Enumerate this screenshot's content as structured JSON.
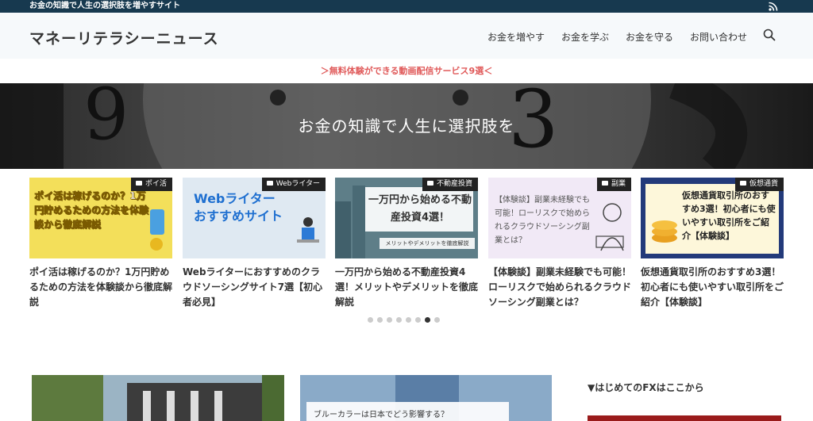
{
  "topbar": {
    "tagline": "お金の知識で人生の選択肢を増やすサイト"
  },
  "header": {
    "site_title": "マネーリテラシーニュース",
    "nav": [
      "お金を増やす",
      "お金を学ぶ",
      "お金を守る",
      "お問い合わせ"
    ]
  },
  "notice": {
    "text": "＞無料体験ができる動画配信サービス9選＜"
  },
  "hero": {
    "text": "お金の知識で人生に選択肢を"
  },
  "cards": [
    {
      "category": "ポイ活",
      "thumb_text": "ポイ活は稼げるのか？1万円貯めるための方法を体験談から徹底解説",
      "title": "ポイ活は稼げるのか？1万円貯めるための方法を体験談から徹底解説"
    },
    {
      "category": "Webライター",
      "thumb_text": "Webライター おすすめサイト",
      "title": "Webライターにおすすめのクラウドソーシングサイト7選【初心者必見】"
    },
    {
      "category": "不動産投資",
      "thumb_text": "一万円から始める不動産投資4選！",
      "thumb_sub": "メリットやデメリットを徹底解説",
      "title": "一万円から始める不動産投資4選！メリットやデメリットを徹底解説"
    },
    {
      "category": "副業",
      "thumb_text": "【体験談】副業未経験でも可能！ローリスクで始められるクラウドソーシング副業とは？",
      "title": "【体験談】副業未経験でも可能！ローリスクで始められるクラウドソーシング副業とは？"
    },
    {
      "category": "仮想通貨",
      "thumb_text": "仮想通貨取引所のおすすめ3選！初心者にも使いやすい取引所をご紹介【体験談】",
      "title": "仮想通貨取引所のおすすめ3選！初心者にも使いやすい取引所をご紹介【体験談】"
    }
  ],
  "dots": {
    "count": 8,
    "active": 6
  },
  "lower": {
    "card2_caption": "ブルーカラーは日本でどう影響する？"
  },
  "sidebar": {
    "heading": "▼はじめてのFXはここから"
  },
  "colors": {
    "topbar": "#17394f",
    "notice": "#e05a5a",
    "header_bg": "#f6f9fb"
  }
}
